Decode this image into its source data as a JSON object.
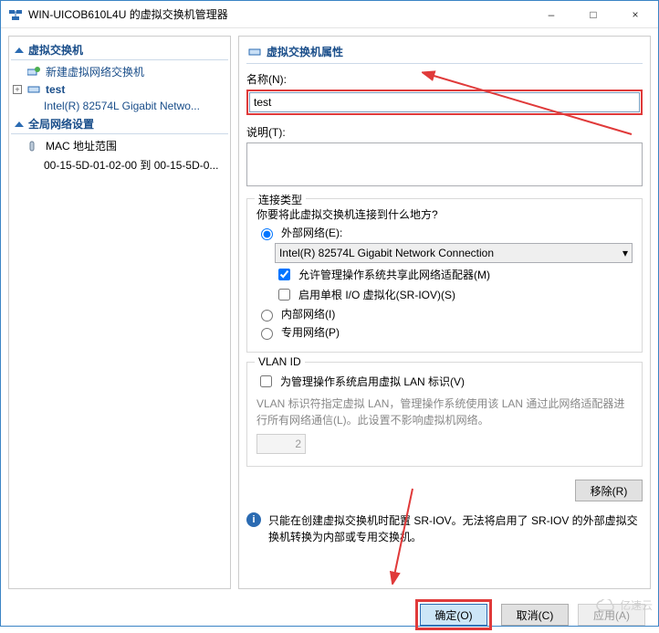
{
  "window": {
    "title": "WIN-UICOB610L4U 的虚拟交换机管理器",
    "minimize": "–",
    "maximize": "□",
    "close": "×"
  },
  "sidebar": {
    "section_vswitch": "虚拟交换机",
    "new_vswitch": "新建虚拟网络交换机",
    "selected_name": "test",
    "selected_nic": "Intel(R) 82574L Gigabit Netwo...",
    "section_global": "全局网络设置",
    "mac_range_label": "MAC 地址范围",
    "mac_range_value": "00-15-5D-01-02-00 到 00-15-5D-0..."
  },
  "props": {
    "header": "虚拟交换机属性",
    "name_label": "名称(N):",
    "name_value": "test",
    "desc_label": "说明(T):",
    "desc_value": "",
    "conn": {
      "legend": "连接类型",
      "question": "你要将此虚拟交换机连接到什么地方?",
      "external": "外部网络(E):",
      "nic_selected": "Intel(R) 82574L Gigabit Network Connection",
      "allow_mgmt": "允许管理操作系统共享此网络适配器(M)",
      "sriov": "启用单根 I/O 虚拟化(SR-IOV)(S)",
      "internal": "内部网络(I)",
      "private": "专用网络(P)"
    },
    "vlan": {
      "legend": "VLAN ID",
      "enable": "为管理操作系统启用虚拟 LAN 标识(V)",
      "hint": "VLAN 标识符指定虚拟 LAN，管理操作系统使用该 LAN 通过此网络适配器进行所有网络通信(L)。此设置不影响虚拟机网络。",
      "value": "2"
    },
    "remove": "移除(R)",
    "info": "只能在创建虚拟交换机时配置 SR-IOV。无法将启用了 SR-IOV 的外部虚拟交换机转换为内部或专用交换机。"
  },
  "footer": {
    "ok": "确定(O)",
    "cancel": "取消(C)",
    "apply": "应用(A)"
  },
  "watermark": "亿速云"
}
